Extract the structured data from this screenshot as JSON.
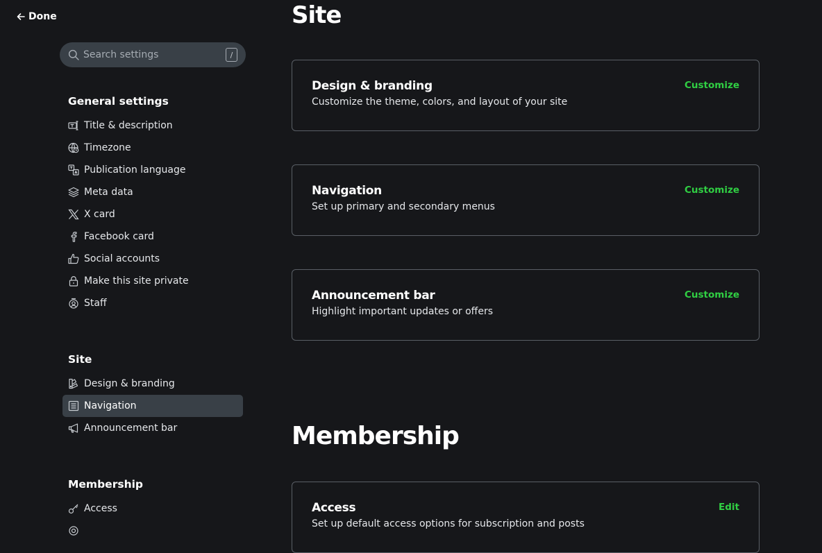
{
  "header": {
    "done_label": "Done"
  },
  "search": {
    "placeholder": "Search settings",
    "shortcut": "/"
  },
  "sidebar": {
    "general": {
      "title": "General settings",
      "items": [
        {
          "label": "Title & description",
          "icon": "title-icon"
        },
        {
          "label": "Timezone",
          "icon": "globe-icon"
        },
        {
          "label": "Publication language",
          "icon": "translate-icon"
        },
        {
          "label": "Meta data",
          "icon": "layers-icon"
        },
        {
          "label": "X card",
          "icon": "x-logo-icon"
        },
        {
          "label": "Facebook card",
          "icon": "facebook-icon"
        },
        {
          "label": "Social accounts",
          "icon": "thumbs-up-icon"
        },
        {
          "label": "Make this site private",
          "icon": "lock-icon"
        },
        {
          "label": "Staff",
          "icon": "staff-icon"
        }
      ]
    },
    "site": {
      "title": "Site",
      "items": [
        {
          "label": "Design & branding",
          "icon": "paintbrush-icon"
        },
        {
          "label": "Navigation",
          "icon": "navigation-icon",
          "active": true
        },
        {
          "label": "Announcement bar",
          "icon": "megaphone-icon"
        }
      ]
    },
    "membership": {
      "title": "Membership",
      "items": [
        {
          "label": "Access",
          "icon": "key-icon"
        }
      ]
    }
  },
  "main": {
    "site_title": "Site",
    "site_cards": [
      {
        "title": "Design & branding",
        "description": "Customize the theme, colors, and layout of your site",
        "action": "Customize"
      },
      {
        "title": "Navigation",
        "description": "Set up primary and secondary menus",
        "action": "Customize"
      },
      {
        "title": "Announcement bar",
        "description": "Highlight important updates or offers",
        "action": "Customize"
      }
    ],
    "membership_title": "Membership",
    "membership_cards": [
      {
        "title": "Access",
        "description": "Set up default access options for subscription and posts",
        "action": "Edit"
      }
    ]
  },
  "colors": {
    "background": "#16171a",
    "accent": "#30cf43",
    "active_item": "#394047",
    "card_border": "#5a5f66"
  }
}
